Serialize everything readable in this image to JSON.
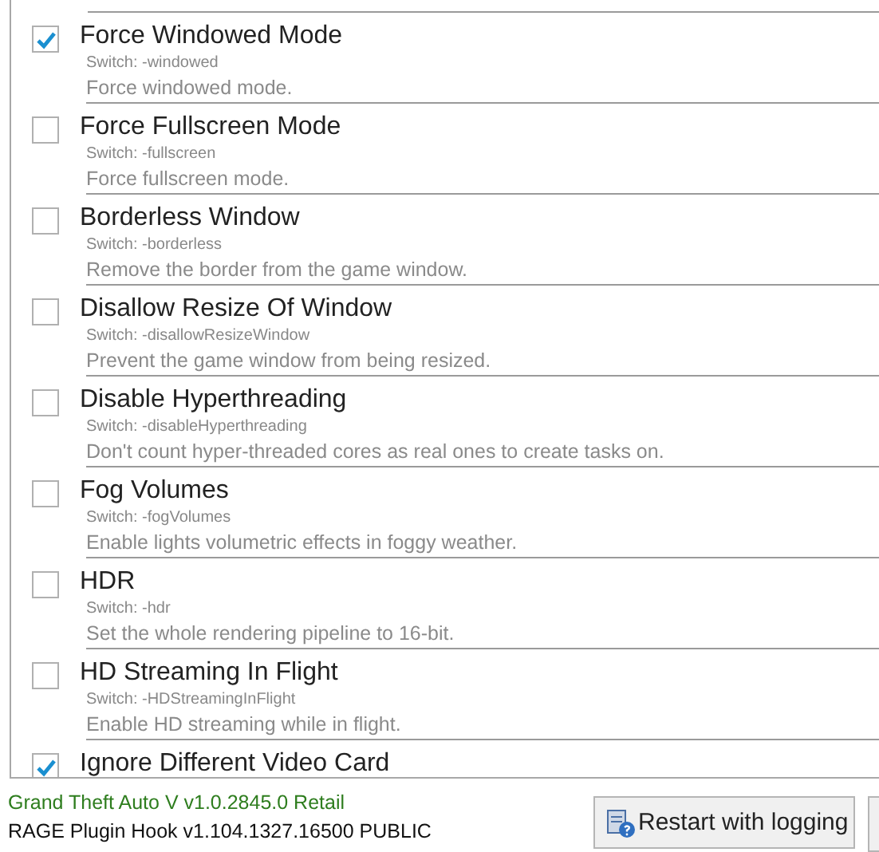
{
  "options_list": {
    "options": [
      {
        "title": "Force Windowed Mode",
        "switch": "Switch: -windowed",
        "description": "Force windowed mode.",
        "checked": true
      },
      {
        "title": "Force Fullscreen Mode",
        "switch": "Switch: -fullscreen",
        "description": "Force fullscreen mode.",
        "checked": false
      },
      {
        "title": "Borderless Window",
        "switch": "Switch: -borderless",
        "description": "Remove the border from the game window.",
        "checked": false
      },
      {
        "title": "Disallow Resize Of Window",
        "switch": "Switch: -disallowResizeWindow",
        "description": "Prevent the game window from being resized.",
        "checked": false
      },
      {
        "title": "Disable Hyperthreading",
        "switch": "Switch: -disableHyperthreading",
        "description": "Don't count hyper-threaded cores as real ones to create tasks on.",
        "checked": false
      },
      {
        "title": "Fog Volumes",
        "switch": "Switch: -fogVolumes",
        "description": "Enable lights volumetric effects in foggy weather.",
        "checked": false
      },
      {
        "title": "HDR",
        "switch": "Switch: -hdr",
        "description": "Set the whole rendering pipeline to 16-bit.",
        "checked": false
      },
      {
        "title": "HD Streaming In Flight",
        "switch": "Switch: -HDStreamingInFlight",
        "description": "Enable HD streaming while in flight.",
        "checked": false
      },
      {
        "title": "Ignore Different Video Card",
        "checked": true
      }
    ]
  },
  "status": {
    "game_version": "Grand Theft Auto V v1.0.2845.0 Retail",
    "hook_version": "RAGE Plugin Hook v1.104.1327.16500 PUBLIC"
  },
  "restart_button": {
    "label": "Restart with logging"
  }
}
